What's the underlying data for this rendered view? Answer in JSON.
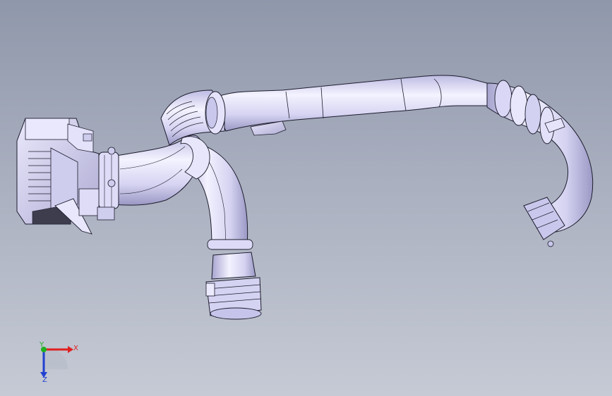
{
  "viewport": {
    "background_top": "#8f97aa",
    "background_bottom": "#c6cad5"
  },
  "model": {
    "body_color": "#d8d6f4",
    "edge_color": "#1c1c2c",
    "highlight_color": "#f7f6ff",
    "shadow_color": "#8e8bb4"
  },
  "triad": {
    "x_label": "X",
    "y_label": "Y",
    "z_label": "Z",
    "x_color": "#e02020",
    "y_color": "#20b020",
    "z_color": "#2040d0"
  }
}
